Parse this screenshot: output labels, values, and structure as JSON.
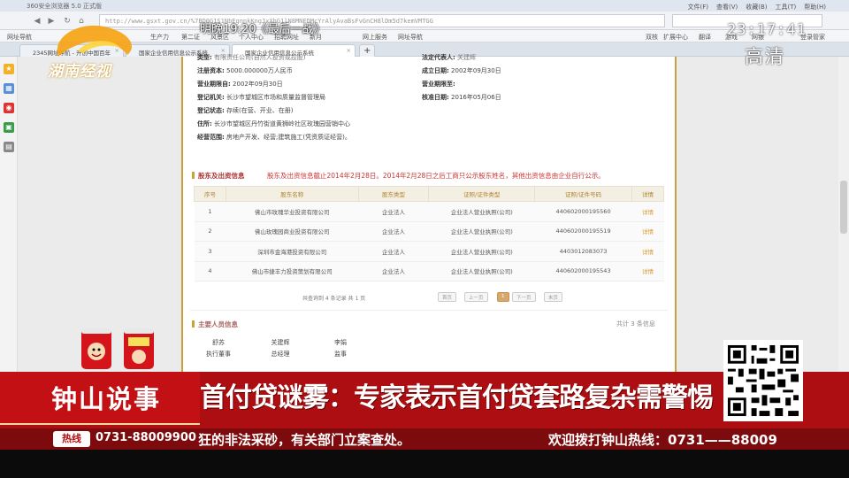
{
  "browser": {
    "title": "360安全浏览器 5.0 正式版",
    "menu": [
      "文件(F)",
      "查看(V)",
      "收藏(B)",
      "工具(T)",
      "帮助(H)"
    ],
    "url": "http://www.gsxt.gov.cn/%7BD0G1S1NbEgnnkKngJxXhG1lN8MNFDMcYrAlyAvaBsFvGnCH8lDm5d7kemVMTGG",
    "bookmarks": [
      "网址导航",
      "生产力",
      "第二证",
      "风景区",
      "个人中心",
      "招聘网址",
      "新月",
      "网上服务",
      "网址导航",
      "双核",
      "扩展中心",
      "翻译",
      "游戏",
      "网银",
      "登录管家"
    ],
    "tabs": [
      {
        "label": "2345网址导航 - 开创中国百年",
        "active": false
      },
      {
        "label": "国家企业信用信息公示系统",
        "active": false
      },
      {
        "label": "国家企业信用信息公示系统",
        "active": true
      }
    ]
  },
  "company": {
    "row1_left_label": "类型:",
    "row1_left_value": "有限责任公司(自然人投资或控股)",
    "row1_right_label": "法定代表人:",
    "row1_right_value": "关建辉",
    "capital_label": "注册资本:",
    "capital_value": "5000.000000万人民币",
    "founded_label": "成立日期:",
    "founded_value": "2002年09月30日",
    "term_from_label": "营业期限自:",
    "term_from_value": "2002年09月30日",
    "term_to_label": "营业期限至:",
    "term_to_value": "",
    "authority_label": "登记机关:",
    "authority_value": "长沙市望城区市场和质量监督管理局",
    "approved_label": "核准日期:",
    "approved_value": "2016年05月06日",
    "status_label": "登记状态:",
    "status_value": "存续(在营、开业、在册)",
    "address_label": "住所:",
    "address_value": "长沙市望城区丹竹街道黄狮岭社区玫瑰园营销中心",
    "scope_label": "经营范围:",
    "scope_value": "房地产开发、经营;建筑施工(凭资质证经营)。"
  },
  "shareholders": {
    "heading": "股东及出资信息",
    "notice": "股东及出资信息截止2014年2月28日。2014年2月28日之后工商只公示股东姓名，其他出资信息由企业自行公示。",
    "columns": [
      "序号",
      "股东名称",
      "股东类型",
      "证照/证件类型",
      "证照/证件号码",
      "详情"
    ],
    "rows": [
      {
        "no": "1",
        "name": "佛山市玫瑰华业投资有限公司",
        "type": "企业法人",
        "idtype": "企业法人营业执照(公司)",
        "idno": "440602000195560",
        "detail": "详情"
      },
      {
        "no": "2",
        "name": "佛山玫瑰园商业投资有限公司",
        "type": "企业法人",
        "idtype": "企业法人营业执照(公司)",
        "idno": "440602000195519",
        "detail": "详情"
      },
      {
        "no": "3",
        "name": "深圳市金海港投资有限公司",
        "type": "企业法人",
        "idtype": "企业法人营业执照(公司)",
        "idno": "440301208307З",
        "detail": "详情"
      },
      {
        "no": "4",
        "name": "佛山市捷丰力投资策划有限公司",
        "type": "企业法人",
        "idtype": "企业法人营业执照(公司)",
        "idno": "440602000195543",
        "detail": "详情"
      }
    ],
    "summary": "共查询到 4 条记录 共 1 页",
    "pager": [
      "首页",
      "上一页",
      "1",
      "下一页",
      "末页"
    ]
  },
  "personnel": {
    "heading": "主要人员信息",
    "count": "共计 3 条信息",
    "people": [
      {
        "name": "舒苏",
        "role": "执行董事"
      },
      {
        "name": "关建辉",
        "role": "总经理"
      },
      {
        "name": "李娟",
        "role": "监事"
      }
    ]
  },
  "overlay": {
    "channel_logo": "湖南经视",
    "promo": "明晚19:20《最后一战》",
    "clock": "23:17:41",
    "hd": "高清"
  },
  "lower_third": {
    "show": "钟山说事",
    "headline": "首付贷谜雾：专家表示首付贷套路复杂需警惕",
    "hotline_tag": "热线",
    "hotline_number": "0731-88009900",
    "ticker": "狂的非法采砂，有关部门立案查处。",
    "ticker_right": "欢迎拨打钟山热线：0731——88009"
  },
  "colors": {
    "accent_red": "#c21014",
    "gold": "#c9a23a",
    "ticker": "#7d0b0d"
  }
}
